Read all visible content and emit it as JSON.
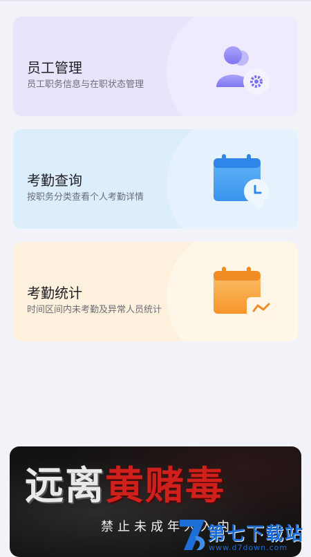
{
  "cards": [
    {
      "title": "员工管理",
      "desc": "员工职务信息与在职状态管理",
      "icon": "users-gear-icon"
    },
    {
      "title": "考勤查询",
      "desc": "按职务分类查看个人考勤详情",
      "icon": "calendar-clock-icon"
    },
    {
      "title": "考勤统计",
      "desc": "时间区间内未考勤及异常人员统计",
      "icon": "calendar-chart-icon"
    }
  ],
  "banner": {
    "slogan_white": "远离",
    "slogan_red": "黄赌毒",
    "sub": "禁止未成年人入内"
  },
  "watermark": {
    "name": "第七下载站",
    "url": "www.d7down.com"
  },
  "colors": {
    "staff_bg": "#e8e4fb",
    "query_bg": "#dcedfc",
    "stats_bg": "#fdf1dd",
    "accent_purple": "#8f86f5",
    "accent_blue": "#3c9cf2",
    "accent_orange": "#f8a53a",
    "slogan_red": "#d0201c"
  }
}
